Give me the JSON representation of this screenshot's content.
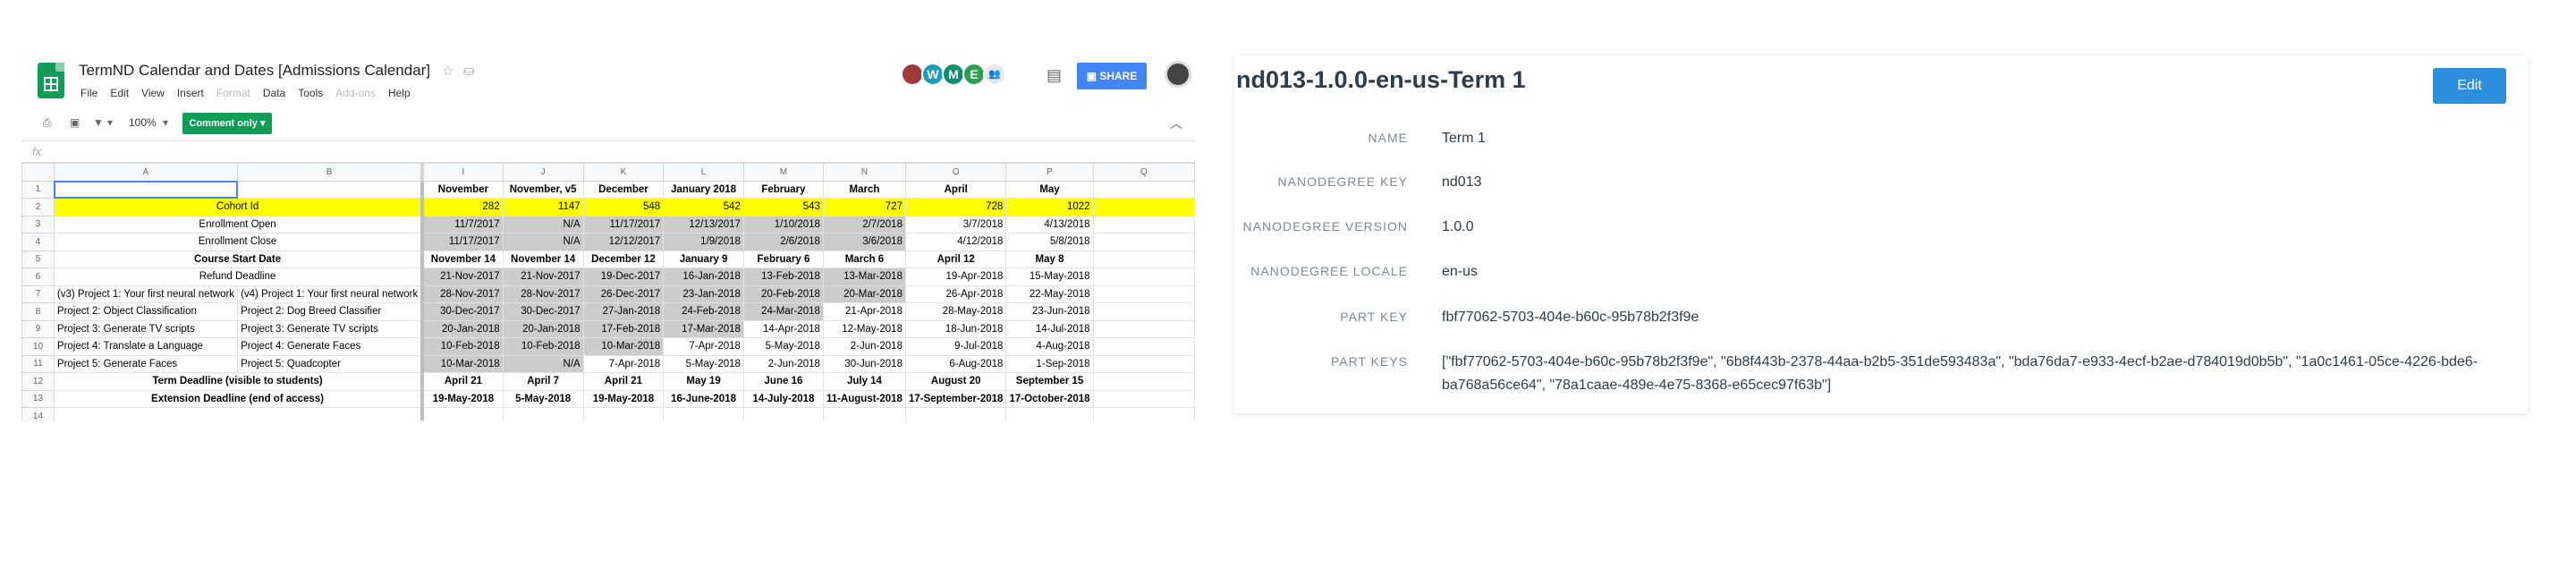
{
  "sheet": {
    "title": "TermND Calendar and Dates [Admissions Calendar]",
    "menu": [
      "File",
      "Edit",
      "View",
      "Insert",
      "Format",
      "Data",
      "Tools",
      "Add-ons",
      "Help"
    ],
    "disabled_menu": [
      "Format",
      "Add-ons"
    ],
    "avatars": [
      "W",
      "M",
      "E"
    ],
    "share_label": "SHARE",
    "zoom": "100%",
    "comment_only_label": "Comment only",
    "fx_label": "fx",
    "col_headers": [
      "A",
      "B",
      "I",
      "J",
      "K",
      "L",
      "M",
      "N",
      "O",
      "P",
      "Q"
    ],
    "rows": [
      [
        "",
        "",
        "November",
        "November, v5",
        "December",
        "January 2018",
        "February",
        "March",
        "April",
        "May",
        ""
      ],
      [
        "Cohort Id",
        "",
        "282",
        "1147",
        "548",
        "542",
        "543",
        "727",
        "728",
        "1022",
        ""
      ],
      [
        "Enrollment Open",
        "",
        "11/7/2017",
        "N/A",
        "11/17/2017",
        "12/13/2017",
        "1/10/2018",
        "2/7/2018",
        "3/7/2018",
        "4/13/2018",
        ""
      ],
      [
        "Enrollment Close",
        "",
        "11/17/2017",
        "N/A",
        "12/12/2017",
        "1/9/2018",
        "2/6/2018",
        "3/6/2018",
        "4/12/2018",
        "5/8/2018",
        ""
      ],
      [
        "Course Start Date",
        "",
        "November 14",
        "November 14",
        "December 12",
        "January 9",
        "February 6",
        "March 6",
        "April 12",
        "May 8",
        ""
      ],
      [
        "Refund Deadline",
        "",
        "21-Nov-2017",
        "21-Nov-2017",
        "19-Dec-2017",
        "16-Jan-2018",
        "13-Feb-2018",
        "13-Mar-2018",
        "19-Apr-2018",
        "15-May-2018",
        ""
      ],
      [
        "(v3) Project 1: Your first neural network",
        "(v4) Project 1: Your first neural network",
        "28-Nov-2017",
        "28-Nov-2017",
        "26-Dec-2017",
        "23-Jan-2018",
        "20-Feb-2018",
        "20-Mar-2018",
        "26-Apr-2018",
        "22-May-2018",
        ""
      ],
      [
        "Project 2: Object Classification",
        "Project 2: Dog Breed Classifier",
        "30-Dec-2017",
        "30-Dec-2017",
        "27-Jan-2018",
        "24-Feb-2018",
        "24-Mar-2018",
        "21-Apr-2018",
        "28-May-2018",
        "23-Jun-2018",
        ""
      ],
      [
        "Project 3: Generate TV scripts",
        "Project 3: Generate TV scripts",
        "20-Jan-2018",
        "20-Jan-2018",
        "17-Feb-2018",
        "17-Mar-2018",
        "14-Apr-2018",
        "12-May-2018",
        "18-Jun-2018",
        "14-Jul-2018",
        ""
      ],
      [
        "Project 4: Translate a Language",
        "Project 4: Generate Faces",
        "10-Feb-2018",
        "10-Feb-2018",
        "10-Mar-2018",
        "7-Apr-2018",
        "5-May-2018",
        "2-Jun-2018",
        "9-Jul-2018",
        "4-Aug-2018",
        ""
      ],
      [
        "Project 5: Generate Faces",
        "Project 5: Quadcopter",
        "10-Mar-2018",
        "N/A",
        "7-Apr-2018",
        "5-May-2018",
        "2-Jun-2018",
        "30-Jun-2018",
        "6-Aug-2018",
        "1-Sep-2018",
        ""
      ],
      [
        "Term Deadline (visible to students)",
        "",
        "April 21",
        "April 7",
        "April 21",
        "May 19",
        "June 16",
        "July 14",
        "August 20",
        "September 15",
        ""
      ],
      [
        "Extension Deadline (end of access)",
        "",
        "19-May-2018",
        "5-May-2018",
        "19-May-2018",
        "16-June-2018",
        "14-July-2018",
        "11-August-2018",
        "17-September-2018",
        "17-October-2018",
        ""
      ],
      [
        "",
        "",
        "",
        "",
        "",
        "",
        "",
        "",
        "",
        "",
        ""
      ]
    ]
  },
  "meta": {
    "title": "nd013-1.0.0-en-us-Term 1",
    "edit_label": "Edit",
    "fields": [
      {
        "label": "NAME",
        "value": "Term 1"
      },
      {
        "label": "NANODEGREE KEY",
        "value": "nd013"
      },
      {
        "label": "NANODEGREE VERSION",
        "value": "1.0.0"
      },
      {
        "label": "NANODEGREE LOCALE",
        "value": "en-us"
      },
      {
        "label": "PART KEY",
        "value": "fbf77062-5703-404e-b60c-95b78b2f3f9e"
      },
      {
        "label": "PART KEYS",
        "value": "[\"fbf77062-5703-404e-b60c-95b78b2f3f9e\", \"6b8f443b-2378-44aa-b2b5-351de593483a\", \"bda76da7-e933-4ecf-b2ae-d784019d0b5b\", \"1a0c1461-05ce-4226-bde6-ba768a56ce64\", \"78a1caae-489e-4e75-8368-e65cec97f63b\"]"
      }
    ]
  },
  "colors": {
    "sheets_green": "#0f9d58",
    "share_blue": "#4285f4",
    "highlight_yellow": "#ffff00",
    "shaded_gray": "#cccccc",
    "edit_blue": "#2d8ee0",
    "meta_text": "#2e3d49"
  }
}
